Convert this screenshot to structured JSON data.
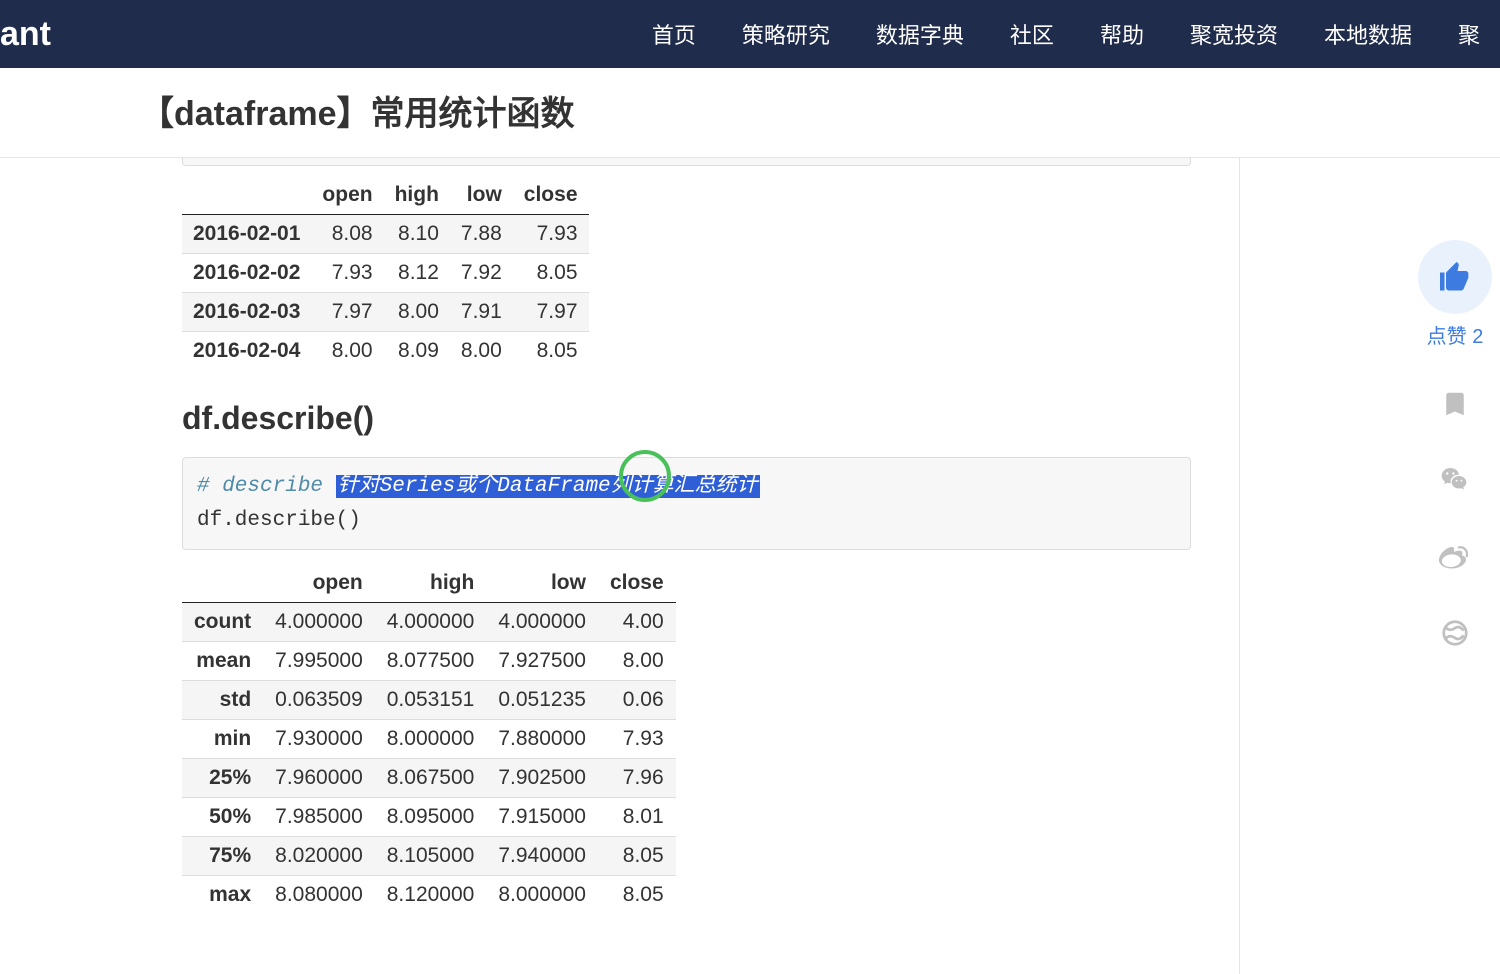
{
  "brand": "ant",
  "nav": [
    "首页",
    "策略研究",
    "数据字典",
    "社区",
    "帮助",
    "聚宽投资",
    "本地数据",
    "聚"
  ],
  "page_title": "【dataframe】常用统计函数",
  "table1": {
    "headers": [
      "",
      "open",
      "high",
      "low",
      "close"
    ],
    "rows": [
      {
        "idx": "2016-02-01",
        "cells": [
          "8.08",
          "8.10",
          "7.88",
          "7.93"
        ]
      },
      {
        "idx": "2016-02-02",
        "cells": [
          "7.93",
          "8.12",
          "7.92",
          "8.05"
        ]
      },
      {
        "idx": "2016-02-03",
        "cells": [
          "7.97",
          "8.00",
          "7.91",
          "7.97"
        ]
      },
      {
        "idx": "2016-02-04",
        "cells": [
          "8.00",
          "8.09",
          "8.00",
          "8.05"
        ]
      }
    ]
  },
  "section_heading": "df.describe()",
  "code": {
    "comment_prefix": "# describe ",
    "highlighted": "针对Series或个DataFrame列计算汇总统计",
    "line2": "df.describe()"
  },
  "table2": {
    "headers": [
      "",
      "open",
      "high",
      "low",
      "close"
    ],
    "rows": [
      {
        "idx": "count",
        "cells": [
          "4.000000",
          "4.000000",
          "4.000000",
          "4.00"
        ]
      },
      {
        "idx": "mean",
        "cells": [
          "7.995000",
          "8.077500",
          "7.927500",
          "8.00"
        ]
      },
      {
        "idx": "std",
        "cells": [
          "0.063509",
          "0.053151",
          "0.051235",
          "0.06"
        ]
      },
      {
        "idx": "min",
        "cells": [
          "7.930000",
          "8.000000",
          "7.880000",
          "7.93"
        ]
      },
      {
        "idx": "25%",
        "cells": [
          "7.960000",
          "8.067500",
          "7.902500",
          "7.96"
        ]
      },
      {
        "idx": "50%",
        "cells": [
          "7.985000",
          "8.095000",
          "7.915000",
          "8.01"
        ]
      },
      {
        "idx": "75%",
        "cells": [
          "8.020000",
          "8.105000",
          "7.940000",
          "8.05"
        ]
      },
      {
        "idx": "max",
        "cells": [
          "8.080000",
          "8.120000",
          "8.000000",
          "8.05"
        ]
      }
    ]
  },
  "like_label": "点赞 2"
}
